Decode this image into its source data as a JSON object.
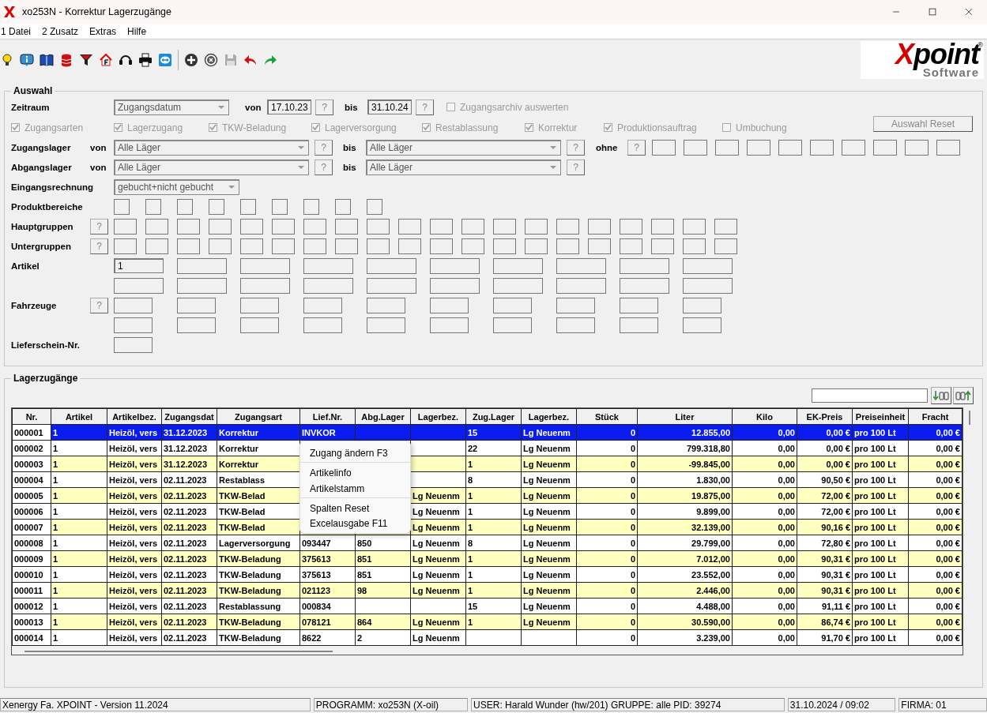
{
  "window": {
    "title": "xo253N - Korrektur Lagerzugänge"
  },
  "menu": [
    "1 Datei",
    "2 Zusatz",
    "Extras",
    "Hilfe"
  ],
  "logo": {
    "name": "Xpoint",
    "mark": "®",
    "sub": "Software"
  },
  "auswahl": {
    "title": "Auswahl",
    "zeitraum": {
      "label": "Zeitraum",
      "type": "Zugangsdatum",
      "von_label": "von",
      "von": "17.10.23",
      "von_help": "?",
      "bis_label": "bis",
      "bis": "31.10.24",
      "bis_help": "?",
      "archive": {
        "label": "Zugangsarchiv auswerten",
        "checked": false,
        "disabled": true
      }
    },
    "reset_button": "Auswahl Reset",
    "arten": [
      {
        "label": "Zugangsarten",
        "checked": true,
        "disabled": true
      },
      {
        "label": "Lagerzugang",
        "checked": true,
        "disabled": true
      },
      {
        "label": "TKW-Beladung",
        "checked": true,
        "disabled": true
      },
      {
        "label": "Lagerversorgung",
        "checked": true,
        "disabled": true
      },
      {
        "label": "Restablassung",
        "checked": true,
        "disabled": true
      },
      {
        "label": "Korrektur",
        "checked": true,
        "disabled": true
      },
      {
        "label": "Produktionsauftrag",
        "checked": true,
        "disabled": true
      },
      {
        "label": "Umbuchung",
        "checked": false,
        "disabled": true
      }
    ],
    "lager": [
      {
        "label": "Zugangslager",
        "von_label": "von",
        "von": "Alle Läger",
        "von_help": "?",
        "bis_label": "bis",
        "bis": "Alle Läger",
        "bis_help": "?",
        "ohne_label": "ohne",
        "ohne_help": "?"
      },
      {
        "label": "Abgangslager",
        "von_label": "von",
        "von": "Alle Läger",
        "von_help": "?",
        "bis_label": "bis",
        "bis": "Alle Läger",
        "bis_help": "?"
      }
    ],
    "eingangsrechnung": {
      "label": "Eingangsrechnung",
      "value": "gebucht+nicht gebucht"
    },
    "produktbereiche": {
      "label": "Produktbereiche"
    },
    "hauptgruppen": {
      "label": "Hauptgruppen",
      "help": "?"
    },
    "untergruppen": {
      "label": "Untergruppen",
      "help": "?"
    },
    "artikel": {
      "label": "Artikel",
      "value": "1"
    },
    "fahrzeuge": {
      "label": "Fahrzeuge",
      "help": "?"
    },
    "lieferschein": {
      "label": "Lieferschein-Nr."
    }
  },
  "lagerzugaenge": {
    "title": "Lagerzugänge",
    "columns": [
      "Nr.",
      "Artikel",
      "Artikelbez.",
      "Zugangsdat",
      "Zugangsart",
      "Lief.Nr.",
      "Abg.Lager",
      "Lagerbez.",
      "Zug.Lager",
      "Lagerbez.",
      "Stück",
      "Liter",
      "Kilo",
      "EK-Preis",
      "Preiseinheit",
      "Fracht"
    ],
    "rows": [
      {
        "selected": true,
        "highlighted": false,
        "cells": [
          "000001",
          "1",
          "Heizöl, vers",
          "31.12.2023",
          "Korrektur",
          "INVKOR",
          null,
          null,
          "15",
          "Lg Neuenm",
          "0",
          "12.855,00",
          "0,00",
          "0,00 €",
          "pro 100 Lt",
          "0,00 €"
        ]
      },
      {
        "selected": false,
        "highlighted": false,
        "cells": [
          "000002",
          "1",
          "Heizöl, vers",
          "31.12.2023",
          "Korrektur",
          null,
          null,
          null,
          "22",
          "Lg Neuenm",
          "0",
          "799.318,80",
          "0,00",
          "0,00 €",
          "pro 100 Lt",
          "0,00 €"
        ]
      },
      {
        "selected": false,
        "highlighted": true,
        "cells": [
          "000003",
          "1",
          "Heizöl, vers",
          "31.12.2023",
          "Korrektur",
          null,
          null,
          null,
          "1",
          "Lg Neuenm",
          "0",
          "-99.845,00",
          "0,00",
          "0,00 €",
          "pro 100 Lt",
          "0,00 €"
        ]
      },
      {
        "selected": false,
        "highlighted": false,
        "cells": [
          "000004",
          "1",
          "Heizöl, vers",
          "02.11.2023",
          "Restablass",
          null,
          null,
          null,
          "8",
          "Lg Neuenm",
          "0",
          "1.830,00",
          "0,00",
          "90,50 €",
          "pro 100 Lt",
          "0,00 €"
        ]
      },
      {
        "selected": false,
        "highlighted": true,
        "cells": [
          "000005",
          "1",
          "Heizöl, vers",
          "02.11.2023",
          "TKW-Belad",
          null,
          null,
          "Lg Neuenm",
          "1",
          "Lg Neuenm",
          "0",
          "19.875,00",
          "0,00",
          "72,00 €",
          "pro 100 Lt",
          "0,00 €"
        ]
      },
      {
        "selected": false,
        "highlighted": false,
        "cells": [
          "000006",
          "1",
          "Heizöl, vers",
          "02.11.2023",
          "TKW-Belad",
          null,
          null,
          "Lg Neuenm",
          "1",
          "Lg Neuenm",
          "0",
          "9.899,00",
          "0,00",
          "72,00 €",
          "pro 100 Lt",
          "0,00 €"
        ]
      },
      {
        "selected": false,
        "highlighted": true,
        "cells": [
          "000007",
          "1",
          "Heizöl, vers",
          "02.11.2023",
          "TKW-Belad",
          null,
          null,
          "Lg Neuenm",
          "1",
          "Lg Neuenm",
          "0",
          "32.139,00",
          "0,00",
          "90,16 €",
          "pro 100 Lt",
          "0,00 €"
        ]
      },
      {
        "selected": false,
        "highlighted": false,
        "cells": [
          "000008",
          "1",
          "Heizöl, vers",
          "02.11.2023",
          "Lagerversorgung",
          "093447",
          "850",
          "Lg Neuenm",
          "8",
          "Lg Neuenm",
          "0",
          "29.799,00",
          "0,00",
          "72,80 €",
          "pro 100 Lt",
          "0,00 €"
        ]
      },
      {
        "selected": false,
        "highlighted": true,
        "cells": [
          "000009",
          "1",
          "Heizöl, vers",
          "02.11.2023",
          "TKW-Beladung",
          "375613",
          "851",
          "Lg Neuenm",
          "1",
          "Lg Neuenm",
          "0",
          "7.012,00",
          "0,00",
          "90,31 €",
          "pro 100 Lt",
          "0,00 €"
        ]
      },
      {
        "selected": false,
        "highlighted": false,
        "cells": [
          "000010",
          "1",
          "Heizöl, vers",
          "02.11.2023",
          "TKW-Beladung",
          "375613",
          "851",
          "Lg Neuenm",
          "1",
          "Lg Neuenm",
          "0",
          "23.552,00",
          "0,00",
          "90,31 €",
          "pro 100 Lt",
          "0,00 €"
        ]
      },
      {
        "selected": false,
        "highlighted": true,
        "cells": [
          "000011",
          "1",
          "Heizöl, vers",
          "02.11.2023",
          "TKW-Beladung",
          "021123",
          "98",
          "Lg Neuenm",
          "1",
          "Lg Neuenm",
          "0",
          "2.446,00",
          "0,00",
          "90,31 €",
          "pro 100 Lt",
          "0,00 €"
        ]
      },
      {
        "selected": false,
        "highlighted": false,
        "cells": [
          "000012",
          "1",
          "Heizöl, vers",
          "02.11.2023",
          "Restablassung",
          "000834",
          null,
          null,
          "15",
          "Lg Neuenm",
          "0",
          "4.488,00",
          "0,00",
          "91,11 €",
          "pro 100 Lt",
          "0,00 €"
        ]
      },
      {
        "selected": false,
        "highlighted": true,
        "cells": [
          "000013",
          "1",
          "Heizöl, vers",
          "02.11.2023",
          "TKW-Beladung",
          "078121",
          "864",
          "Lg Neuenm",
          "1",
          "Lg Neuenm",
          "0",
          "30.590,00",
          "0,00",
          "86,74 €",
          "pro 100 Lt",
          "0,00 €"
        ]
      },
      {
        "selected": false,
        "highlighted": false,
        "cells": [
          "000014",
          "1",
          "Heizöl, vers",
          "02.11.2023",
          "TKW-Beladung",
          "8622",
          "2",
          "Lg Neuenm",
          null,
          null,
          "0",
          "3.239,00",
          "0,00",
          "91,70 €",
          "pro 100 Lt",
          "0,00 €"
        ]
      }
    ],
    "context_menu": [
      {
        "label": "Zugang ändern F3",
        "separator_after": true
      },
      {
        "label": "Artikelinfo",
        "separator_after": false
      },
      {
        "label": "Artikelstamm",
        "separator_after": true
      },
      {
        "label": "Spalten Reset",
        "separator_after": false
      },
      {
        "label": "Excelausgabe F11",
        "separator_after": false
      }
    ]
  },
  "status_bar": [
    "Xenergy Fa. XPOINT - Version 11.2024",
    "PROGRAMM: xo253N (X-oil)",
    "USER: Harald Wunder (hw/201)  GRUPPE: alle  PID: 39274",
    "31.10.2024 / 09:02",
    "FIRMA: 01"
  ]
}
